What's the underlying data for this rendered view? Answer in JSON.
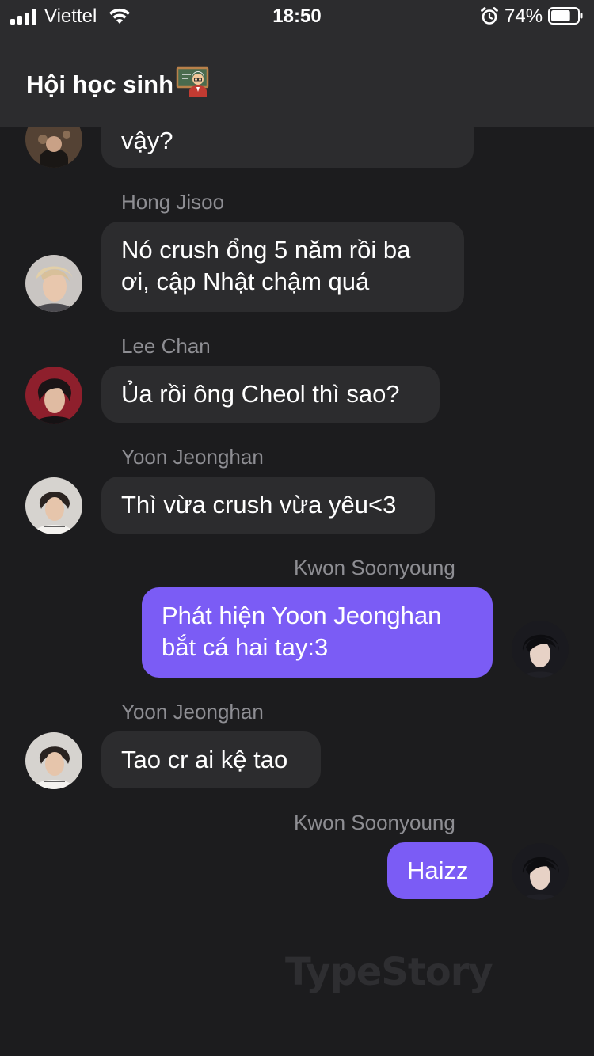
{
  "status_bar": {
    "carrier": "Viettel",
    "time": "18:50",
    "battery_percent": "74%",
    "battery_level": 0.74,
    "signal_bars": 4
  },
  "header": {
    "title": "Hội học sinh"
  },
  "messages": [
    {
      "sender": "",
      "direction": "incoming",
      "lines": [
        "vậy?"
      ]
    },
    {
      "sender": "Hong Jisoo",
      "direction": "incoming",
      "lines": [
        "Nó crush ổng 5 năm rồi ba",
        "ơi, cập Nhật chậm quá"
      ]
    },
    {
      "sender": "Lee Chan",
      "direction": "incoming",
      "lines": [
        "Ủa rồi ông Cheol thì sao?"
      ]
    },
    {
      "sender": "Yoon Jeonghan",
      "direction": "incoming",
      "lines": [
        "Thì vừa crush vừa yêu<3"
      ]
    },
    {
      "sender": "Kwon Soonyoung",
      "direction": "outgoing",
      "lines": [
        "Phát hiện Yoon Jeonghan",
        "bắt cá hai tay:3"
      ]
    },
    {
      "sender": "Yoon Jeonghan",
      "direction": "incoming",
      "lines": [
        "Tao cr ai kệ tao"
      ]
    },
    {
      "sender": "Kwon Soonyoung",
      "direction": "outgoing",
      "lines": [
        "Haizz"
      ]
    }
  ],
  "watermark": "TypeStory",
  "colors": {
    "background": "#1c1c1e",
    "header": "#2c2c2e",
    "incoming_bubble": "#2c2c2e",
    "outgoing_bubble": "#7b5cf5",
    "sender_name": "#8e8e93"
  }
}
